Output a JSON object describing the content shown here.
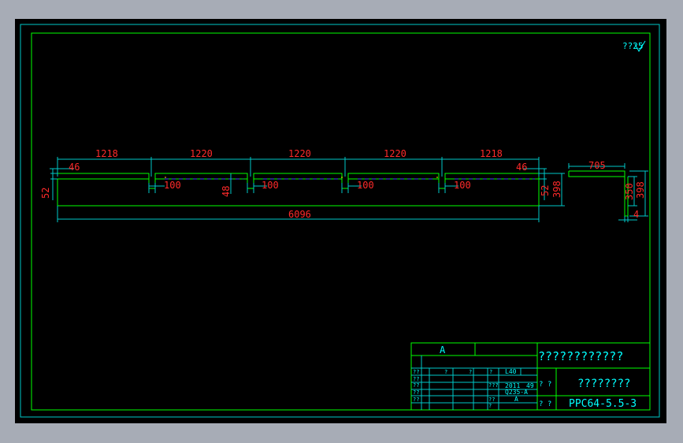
{
  "drawing": {
    "roughness_mark": "??25",
    "dimensions": {
      "seg1": "1218",
      "seg2": "1220",
      "seg3": "1220",
      "seg4": "1220",
      "seg5": "1218",
      "left_tab": "46",
      "right_tab": "46",
      "slot1": "100",
      "slot2": "100",
      "slot3": "100",
      "slot4": "100",
      "left_height": "52",
      "notch_depth": "48",
      "right_height": "52",
      "total_height": "398",
      "total_length": "6096",
      "side_length": "705",
      "side_height": "350",
      "side_total": "398",
      "side_thickness": "4"
    }
  },
  "title_block": {
    "revision": "A",
    "company": "????????????",
    "part_name": "????????",
    "drawing_number": "PPC64-5.5-3",
    "material_1": "L40",
    "material_2": "2011",
    "material_3": "Q235-A",
    "material_4": "A",
    "scale": "49",
    "row_labels": [
      "??",
      "??",
      "?",
      "?",
      "?"
    ],
    "small_a": "? ?",
    "small_b": "? ?",
    "small_c": "??",
    "small_d": "??",
    "small_e": "??",
    "small_f": "???",
    "small_g": "??",
    "small_h": "?"
  }
}
